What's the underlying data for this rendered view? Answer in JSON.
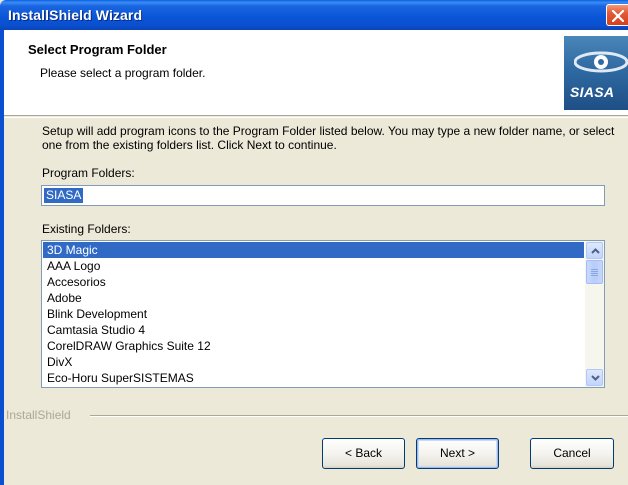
{
  "window": {
    "title": "InstallShield Wizard",
    "close_icon": "close-icon"
  },
  "header": {
    "title": "Select Program Folder",
    "subtitle": "Please select a program folder.",
    "logo_text": "SIASA"
  },
  "instructions": "Setup will add program icons to the Program Folder listed below.  You may type a new folder name, or select one from the existing folders list.  Click Next to continue.",
  "program_folder": {
    "label": "Program Folders:",
    "value": "SIASA"
  },
  "existing_folders": {
    "label": "Existing Folders:",
    "items": [
      {
        "label": "3D Magic",
        "selected": true
      },
      {
        "label": "AAA Logo",
        "selected": false
      },
      {
        "label": "Accesorios",
        "selected": false
      },
      {
        "label": "Adobe",
        "selected": false
      },
      {
        "label": "Blink Development",
        "selected": false
      },
      {
        "label": "Camtasia Studio 4",
        "selected": false
      },
      {
        "label": "CorelDRAW Graphics Suite 12",
        "selected": false
      },
      {
        "label": "DivX",
        "selected": false
      },
      {
        "label": "Eco-Horu SuperSISTEMAS",
        "selected": false
      }
    ]
  },
  "footer": {
    "brand": "InstallShield",
    "back_label": "< Back",
    "next_label": "Next >",
    "cancel_label": "Cancel"
  },
  "colors": {
    "titlebar": "#0a56d8",
    "selection": "#316ac5",
    "dialog_bg": "#ece9d8"
  }
}
